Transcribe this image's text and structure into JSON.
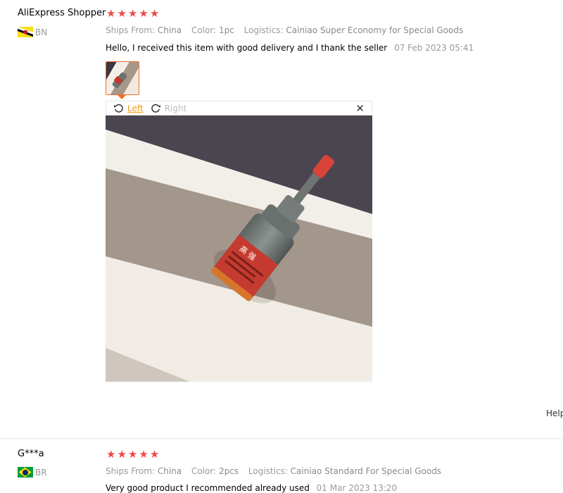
{
  "reviews": [
    {
      "author": "AliExpress Shopper",
      "country_code": "BN",
      "rating": 5,
      "ships_from_label": "Ships From:",
      "ships_from": "China",
      "color_label": "Color:",
      "color": "1pc",
      "logistics_label": "Logistics:",
      "logistics": "Cainiao Super Economy for Special Goods",
      "comment": "Hello, I received this item with good delivery and I thank the seller",
      "date": "07 Feb 2023 05:41",
      "viewer": {
        "rotate_left": "Left",
        "rotate_right": "Right",
        "close": "✕"
      },
      "helpful_label": "Help"
    },
    {
      "author": "G***a",
      "country_code": "BR",
      "rating": 5,
      "ships_from_label": "Ships From:",
      "ships_from": "China",
      "color_label": "Color:",
      "color": "2pcs",
      "logistics_label": "Logistics:",
      "logistics": "Cainiao Standard For Special Goods",
      "comment": "Very good product I recommended already used",
      "date": "01 Mar 2023 13:20"
    }
  ],
  "colors": {
    "star": "#ef4848",
    "accent": "#f36f24",
    "link": "#f39c12"
  },
  "icons": {
    "star": "star-icon",
    "rotate_left": "rotate-left-icon",
    "rotate_right": "rotate-right-icon",
    "close": "close-icon"
  }
}
